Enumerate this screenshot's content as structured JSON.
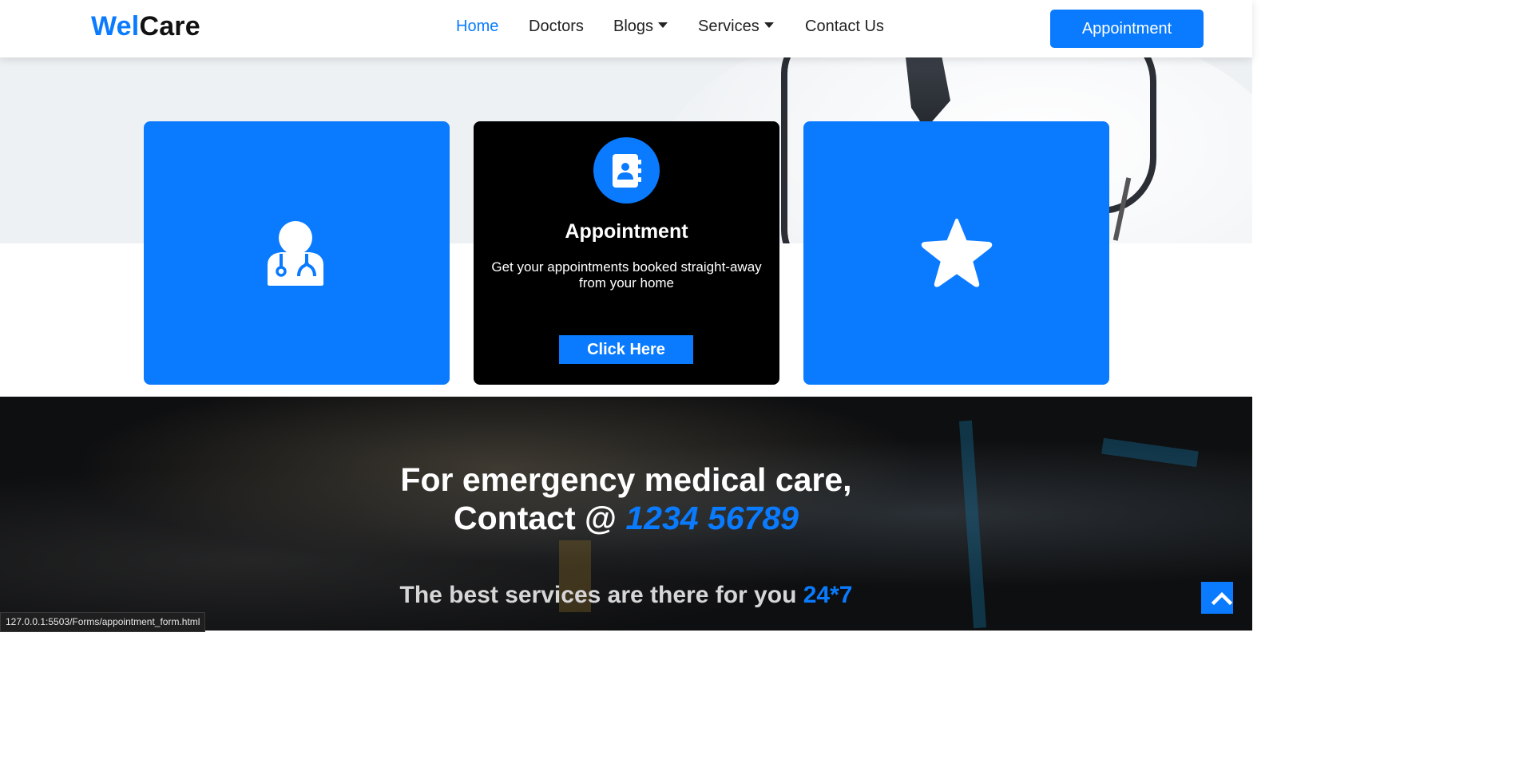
{
  "header": {
    "logo": {
      "part1": "Wel",
      "part2": "Care"
    },
    "nav": [
      {
        "label": "Home",
        "active": true
      },
      {
        "label": "Doctors"
      },
      {
        "label": "Blogs",
        "dropdown": true
      },
      {
        "label": "Services",
        "dropdown": true
      },
      {
        "label": "Contact Us"
      }
    ],
    "cta_label": "Appointment"
  },
  "cards": [
    {
      "icon": "doctor-icon"
    },
    {
      "icon": "address-book-icon",
      "title": "Appointment",
      "text": "Get your appointments booked straight-away from your home",
      "button": "Click Here"
    },
    {
      "icon": "star-icon"
    }
  ],
  "emergency": {
    "line1": "For emergency medical care,",
    "line2_prefix": "Contact @ ",
    "phone": "1234 56789",
    "sub_prefix": "The best services are there for you ",
    "sub_highlight": "24*7"
  },
  "scroll_top_icon": "chevron-up-icon",
  "status_url": "127.0.0.1:5503/Forms/appointment_form.html",
  "colors": {
    "primary": "#0a7bff",
    "dark": "#000000",
    "text": "#222222"
  }
}
